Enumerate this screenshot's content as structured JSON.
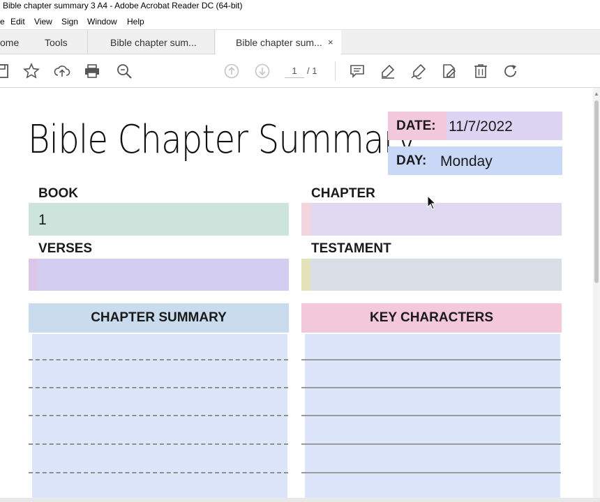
{
  "window": {
    "title": "Bible chapter summary 3 A4 - Adobe Acrobat Reader DC (64-bit)"
  },
  "menu": [
    "e",
    "Edit",
    "View",
    "Sign",
    "Window",
    "Help"
  ],
  "tabs": {
    "home": "ome",
    "tools": "Tools",
    "doc1": "Bible chapter sum...",
    "doc2": "Bible chapter sum...",
    "close": "×"
  },
  "toolbar": {
    "icons": [
      "save-icon",
      "star-icon",
      "upload-icon",
      "print-icon",
      "zoom-icon",
      "prev-page-icon",
      "next-page-icon",
      "comment-icon",
      "highlight-icon",
      "sign-icon",
      "edit-pdf-icon",
      "delete-icon",
      "rotate-icon"
    ],
    "page_current": "1",
    "page_total": "/ 1"
  },
  "document": {
    "title": "Bible Chapter Summary",
    "date_label": "DATE:",
    "date_value": "11/7/2022",
    "day_label": "DAY:",
    "day_value": "Monday",
    "book_label": "BOOK",
    "book_value": "1",
    "chapter_label": "CHAPTER",
    "chapter_value": "",
    "verses_label": "VERSES",
    "verses_value": "",
    "testament_label": "TESTAMENT",
    "testament_value": "",
    "summary_header": "CHAPTER SUMMARY",
    "characters_header": "KEY CHARACTERS"
  },
  "colors": {
    "date_label_bg": "#f2c9dc",
    "date_value_bg": "#ddd3f2",
    "day_bg": "#c9d8f6",
    "book_bg": "#cde4dd",
    "chapter_bg": "#ded8f0",
    "verses_bg": "#d3cdf2",
    "testament_bg": "#d9dde6",
    "summary_header_bg": "#c9dcee",
    "characters_header_bg": "#f3c9da",
    "lines_bg": "#dde5fb"
  }
}
